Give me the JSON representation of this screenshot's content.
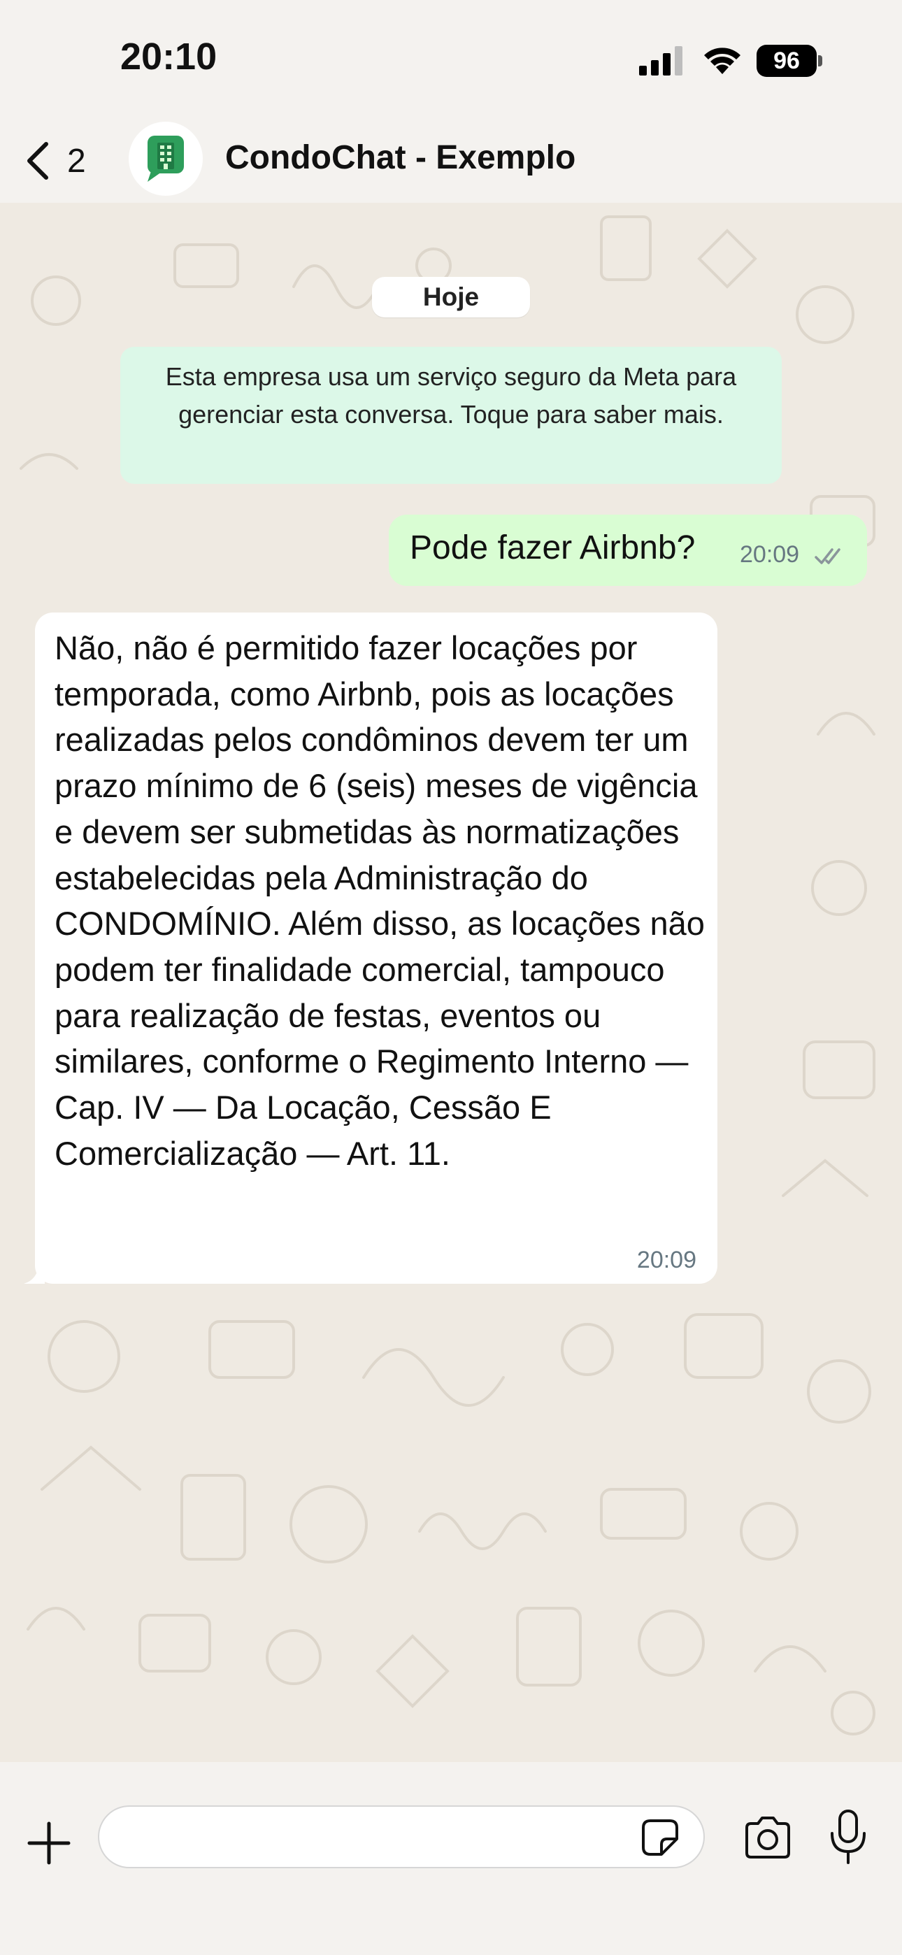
{
  "status_bar": {
    "time": "20:10",
    "battery": "96",
    "icons": [
      "signal-icon",
      "wifi-icon",
      "battery-icon"
    ]
  },
  "header": {
    "back_count": "2",
    "title": "CondoChat - Exemplo",
    "avatar_icon": "building-chat-icon",
    "avatar_color": "#2e9e5b"
  },
  "chat": {
    "date_label": "Hoje",
    "system_notice": "Esta empresa usa um serviço seguro da Meta para gerenciar esta conversa. Toque para saber mais.",
    "messages": [
      {
        "direction": "outgoing",
        "text": "Pode fazer Airbnb?",
        "time": "20:09",
        "status": "read-ticks-icon"
      },
      {
        "direction": "incoming",
        "text": "Não, não é permitido fazer locações por temporada, como Airbnb, pois as locações realizadas pelos condôminos devem ter um prazo mínimo de 6 (seis) meses de vigência e devem ser submetidas às normatizações estabelecidas pela Administração do CONDOMÍNIO. Além disso, as locações não podem ter finalidade comercial, tampouco para realização de festas, eventos ou similares, conforme o Regimento Interno — Cap. IV — Da Locação, Cessão E Comercialização — Art. 11.",
        "time": "20:09"
      }
    ]
  },
  "composer": {
    "input_value": "",
    "icons": [
      "plus-icon",
      "sticker-icon",
      "camera-icon",
      "microphone-icon"
    ]
  },
  "colors": {
    "background": "#efeae2",
    "outgoing_bubble": "#d9fdd3",
    "incoming_bubble": "#ffffff",
    "system_notice": "#dcf8e8",
    "timestamp": "#667781"
  }
}
